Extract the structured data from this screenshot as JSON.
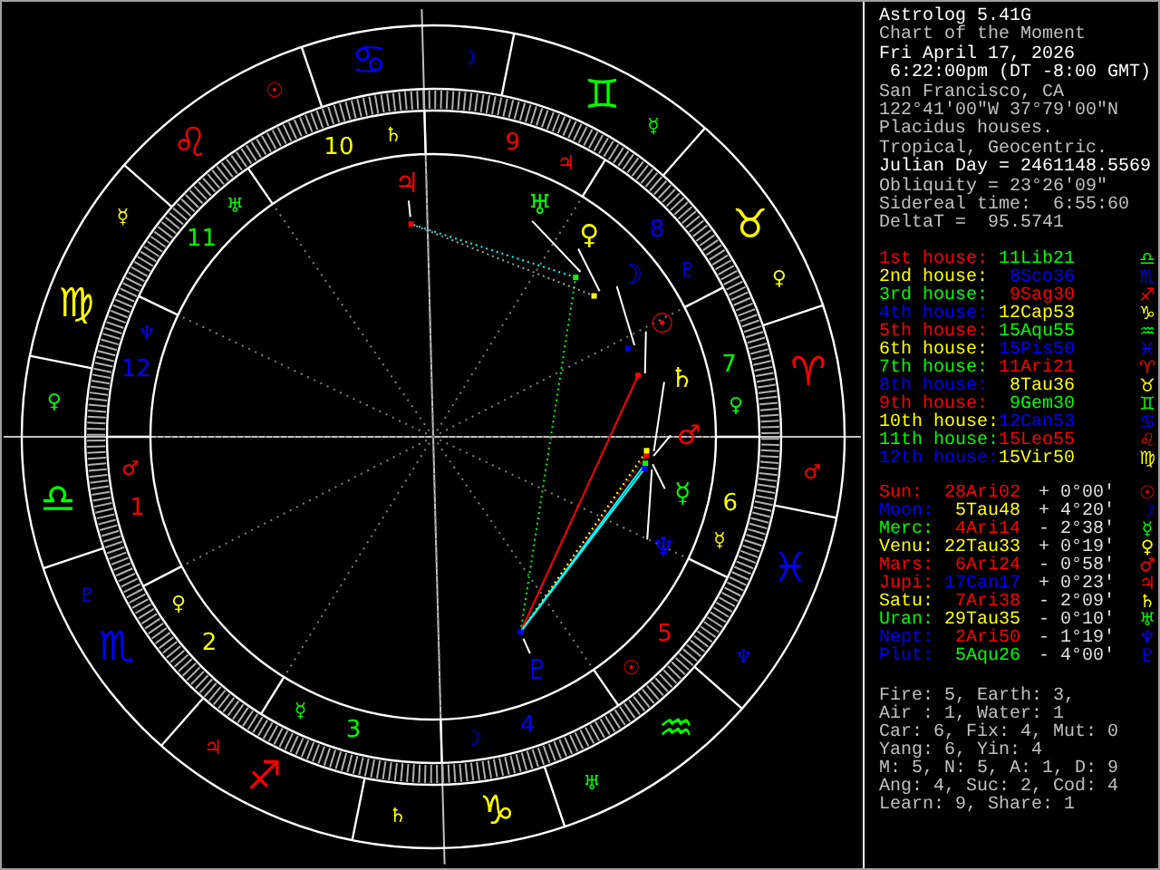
{
  "header": [
    {
      "text": "Astrolog 5.41G",
      "bright": true
    },
    {
      "text": "Chart of the Moment",
      "bright": false
    },
    {
      "text": "Fri April 17, 2026",
      "bright": true
    },
    {
      "text": " 6:22:00pm (DT -8:00 GMT)",
      "bright": true
    },
    {
      "text": "San Francisco, CA",
      "bright": false
    },
    {
      "text": "122°41'00\"W 37°79'00\"N",
      "bright": false
    },
    {
      "text": "Placidus houses.",
      "bright": false
    },
    {
      "text": "Tropical, Geocentric.",
      "bright": false
    },
    {
      "text": "Julian Day = 2461148.5569",
      "bright": true
    },
    {
      "text": "Obliquity = 23°26'09\"",
      "bright": false
    },
    {
      "text": "Sidereal time:  6:55:60",
      "bright": false
    },
    {
      "text": "DeltaT =  95.5741",
      "bright": false
    }
  ],
  "signs": [
    {
      "glyph": "♈",
      "ruler": "♂",
      "color": "#ff0000"
    },
    {
      "glyph": "♉",
      "ruler": "♀",
      "color": "#ffff00"
    },
    {
      "glyph": "♊",
      "ruler": "☿",
      "color": "#00ff00"
    },
    {
      "glyph": "♋",
      "ruler": "☽",
      "color": "#0000ff"
    },
    {
      "glyph": "♌",
      "ruler": "☉",
      "color": "#ff0000"
    },
    {
      "glyph": "♍",
      "ruler": "☿",
      "color": "#ffff00"
    },
    {
      "glyph": "♎",
      "ruler": "♀",
      "color": "#00ff00"
    },
    {
      "glyph": "♏",
      "ruler": "♇",
      "color": "#0000ff"
    },
    {
      "glyph": "♐",
      "ruler": "♃",
      "color": "#ff0000"
    },
    {
      "glyph": "♑",
      "ruler": "♄",
      "color": "#ffff00"
    },
    {
      "glyph": "♒",
      "ruler": "♅",
      "color": "#00ff00"
    },
    {
      "glyph": "♓",
      "ruler": "♆",
      "color": "#0000ff"
    }
  ],
  "houses": [
    {
      "number": "1",
      "ruler": "♂",
      "label": "1st house:",
      "color": "#ff0000",
      "cusp": {
        "text": "11Lib21",
        "color": "#00ff00"
      },
      "sign_glyph": "♎"
    },
    {
      "number": "2",
      "ruler": "♀",
      "label": "2nd house:",
      "color": "#ffff00",
      "cusp": {
        "text": "8Sco36",
        "color": "#0000ff"
      },
      "sign_glyph": "♏"
    },
    {
      "number": "3",
      "ruler": "☿",
      "label": "3rd house:",
      "color": "#00ff00",
      "cusp": {
        "text": "9Sag30",
        "color": "#ff0000"
      },
      "sign_glyph": "♐"
    },
    {
      "number": "4",
      "ruler": "☽",
      "label": "4th house:",
      "color": "#0000ff",
      "cusp": {
        "text": "12Cap53",
        "color": "#ffff00"
      },
      "sign_glyph": "♑"
    },
    {
      "number": "5",
      "ruler": "☉",
      "label": "5th house:",
      "color": "#ff0000",
      "cusp": {
        "text": "15Aqu55",
        "color": "#00ff00"
      },
      "sign_glyph": "♒"
    },
    {
      "number": "6",
      "ruler": "☿",
      "label": "6th house:",
      "color": "#ffff00",
      "cusp": {
        "text": "15Pis50",
        "color": "#0000ff"
      },
      "sign_glyph": "♓"
    },
    {
      "number": "7",
      "ruler": "♀",
      "label": "7th house:",
      "color": "#00ff00",
      "cusp": {
        "text": "11Ari21",
        "color": "#ff0000"
      },
      "sign_glyph": "♈"
    },
    {
      "number": "8",
      "ruler": "♇",
      "label": "8th house:",
      "color": "#0000ff",
      "cusp": {
        "text": "8Tau36",
        "color": "#ffff00"
      },
      "sign_glyph": "♉"
    },
    {
      "number": "9",
      "ruler": "♃",
      "label": "9th house:",
      "color": "#ff0000",
      "cusp": {
        "text": "9Gem30",
        "color": "#00ff00"
      },
      "sign_glyph": "♊"
    },
    {
      "number": "10",
      "ruler": "♄",
      "label": "10th house:",
      "color": "#ffff00",
      "cusp": {
        "text": "12Can53",
        "color": "#0000ff"
      },
      "sign_glyph": "♋"
    },
    {
      "number": "11",
      "ruler": "♅",
      "label": "11th house:",
      "color": "#00ff00",
      "cusp": {
        "text": "15Leo55",
        "color": "#ff0000"
      },
      "sign_glyph": "♌"
    },
    {
      "number": "12",
      "ruler": "♆",
      "label": "12th house:",
      "color": "#0000ff",
      "cusp": {
        "text": "15Vir50",
        "color": "#ffff00"
      },
      "sign_glyph": "♍"
    }
  ],
  "planets": [
    {
      "name": "Sun:",
      "glyph": "☉",
      "color": "#ff0000",
      "position": {
        "text": "28Ari02",
        "color": "#ff0000"
      },
      "latitude": "+ 0°00'"
    },
    {
      "name": "Moon:",
      "glyph": "☽",
      "color": "#0000ff",
      "position": {
        "text": "5Tau48",
        "color": "#ffff00"
      },
      "latitude": "+ 4°20'"
    },
    {
      "name": "Merc:",
      "glyph": "☿",
      "color": "#00ff00",
      "position": {
        "text": "4Ari14",
        "color": "#ff0000"
      },
      "latitude": "- 2°38'"
    },
    {
      "name": "Venu:",
      "glyph": "♀",
      "color": "#ffff00",
      "position": {
        "text": "22Tau33",
        "color": "#ffff00"
      },
      "latitude": "+ 0°19'"
    },
    {
      "name": "Mars:",
      "glyph": "♂",
      "color": "#ff0000",
      "position": {
        "text": "6Ari24",
        "color": "#ff0000"
      },
      "latitude": "- 0°58'"
    },
    {
      "name": "Jupi:",
      "glyph": "♃",
      "color": "#ff0000",
      "position": {
        "text": "17Can17",
        "color": "#0000ff"
      },
      "latitude": "+ 0°23'"
    },
    {
      "name": "Satu:",
      "glyph": "♄",
      "color": "#ffff00",
      "position": {
        "text": "7Ari38",
        "color": "#ff0000"
      },
      "latitude": "- 2°09'"
    },
    {
      "name": "Uran:",
      "glyph": "♅",
      "color": "#00ff00",
      "position": {
        "text": "29Tau35",
        "color": "#ffff00"
      },
      "latitude": "- 0°10'"
    },
    {
      "name": "Nept:",
      "glyph": "♆",
      "color": "#0000ff",
      "position": {
        "text": "2Ari50",
        "color": "#ff0000"
      },
      "latitude": "- 1°19'"
    },
    {
      "name": "Plut:",
      "glyph": "♇",
      "color": "#0000ff",
      "position": {
        "text": "5Aqu26",
        "color": "#00ff00"
      },
      "latitude": "- 4°00'"
    }
  ],
  "stats": [
    "Fire: 5, Earth: 3,",
    "Air : 1, Water: 1",
    "Car: 6, Fix: 4, Mut: 0",
    "Yang: 6, Yin: 4",
    "M: 5, N: 5, A: 1, D: 9",
    "Ang: 4, Suc: 2, Cod: 4",
    "Learn: 9, Share: 1"
  ]
}
